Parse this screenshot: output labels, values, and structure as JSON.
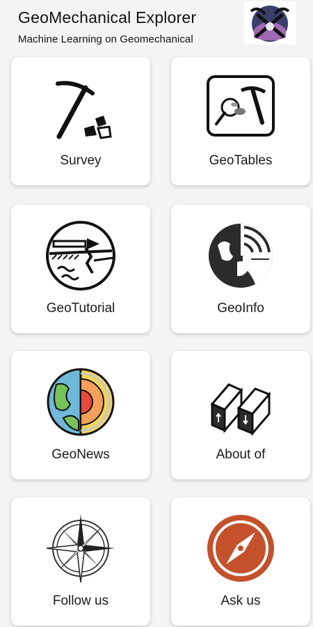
{
  "header": {
    "title": "GeoMechanical Explorer",
    "subtitle": "Machine Learning on Geomechanical",
    "logo_icon": "pickaxe-logo-icon"
  },
  "menu": [
    {
      "label": "Survey",
      "icon": "pickaxe-rocks-icon"
    },
    {
      "label": "GeoTables",
      "icon": "magnifier-pickaxe-icon"
    },
    {
      "label": "GeoTutorial",
      "icon": "fault-layers-icon"
    },
    {
      "label": "GeoInfo",
      "icon": "globe-signal-icon"
    },
    {
      "label": "GeoNews",
      "icon": "earth-core-icon"
    },
    {
      "label": "About of",
      "icon": "fault-blocks-icon"
    },
    {
      "label": "Follow us",
      "icon": "compass-rose-icon"
    },
    {
      "label": "Ask us",
      "icon": "compass-needle-icon"
    }
  ],
  "colors": {
    "background": "#f4f4f4",
    "card": "#ffffff",
    "ask_us_red": "#c4512b",
    "geonews_blue": "#6fb8d8",
    "geonews_green": "#78c25b",
    "geonews_yellow": "#f2d45a"
  }
}
